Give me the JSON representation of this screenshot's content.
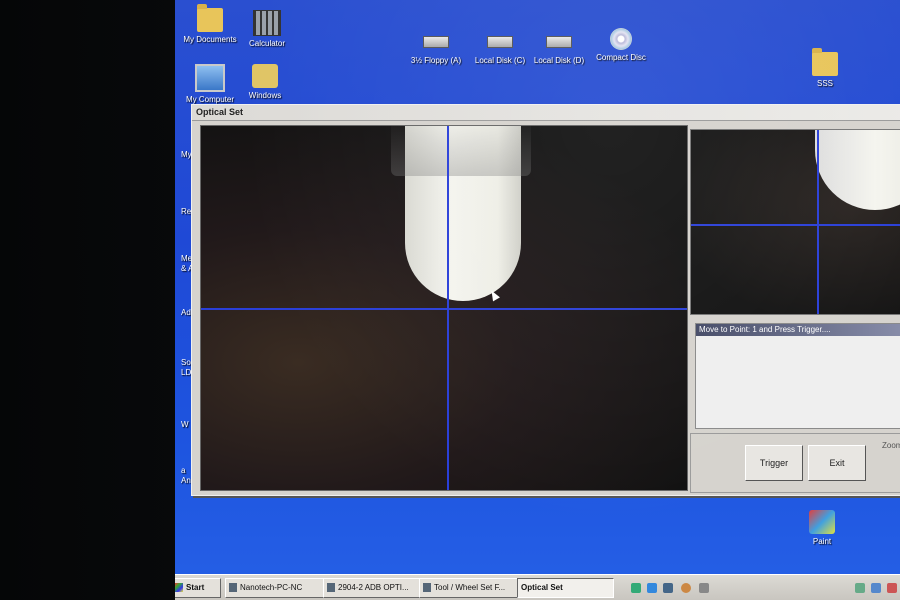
{
  "desktop": {
    "icons": [
      {
        "label": "My Documents",
        "icon": "folder-icon"
      },
      {
        "label": "Calculator",
        "icon": "calculator-icon"
      },
      {
        "label": "My Computer",
        "icon": "computer-icon"
      },
      {
        "label": "Windows",
        "icon": "search-folder-icon"
      },
      {
        "label": "3½ Floppy (A)",
        "icon": "floppy-drive-icon"
      },
      {
        "label": "Local Disk (C)",
        "icon": "disk-drive-icon"
      },
      {
        "label": "Local Disk (D)",
        "icon": "disk-drive-icon"
      },
      {
        "label": "Compact Disc",
        "icon": "cd-icon"
      },
      {
        "label": "SSS",
        "icon": "folder-icon"
      },
      {
        "label": "Paint",
        "icon": "paint-icon"
      }
    ],
    "clipped_labels": [
      "My",
      "Re",
      "Mea",
      "& A",
      "Adob",
      "Sold",
      "LDVD",
      "W",
      "a",
      "An"
    ]
  },
  "window": {
    "title": "Optical Set",
    "message": "Move to Point:  1 and Press Trigger....",
    "trigger_label": "Trigger",
    "exit_label": "Exit",
    "zoom_label": "Zoom"
  },
  "taskbar": {
    "start_label": "Start",
    "items": [
      {
        "label": "Nanotech-PC-NC"
      },
      {
        "label": "2904-2 ADB OPTI..."
      },
      {
        "label": "Tool / Wheel Set F..."
      },
      {
        "label": "Optical Set",
        "active": true
      }
    ]
  }
}
